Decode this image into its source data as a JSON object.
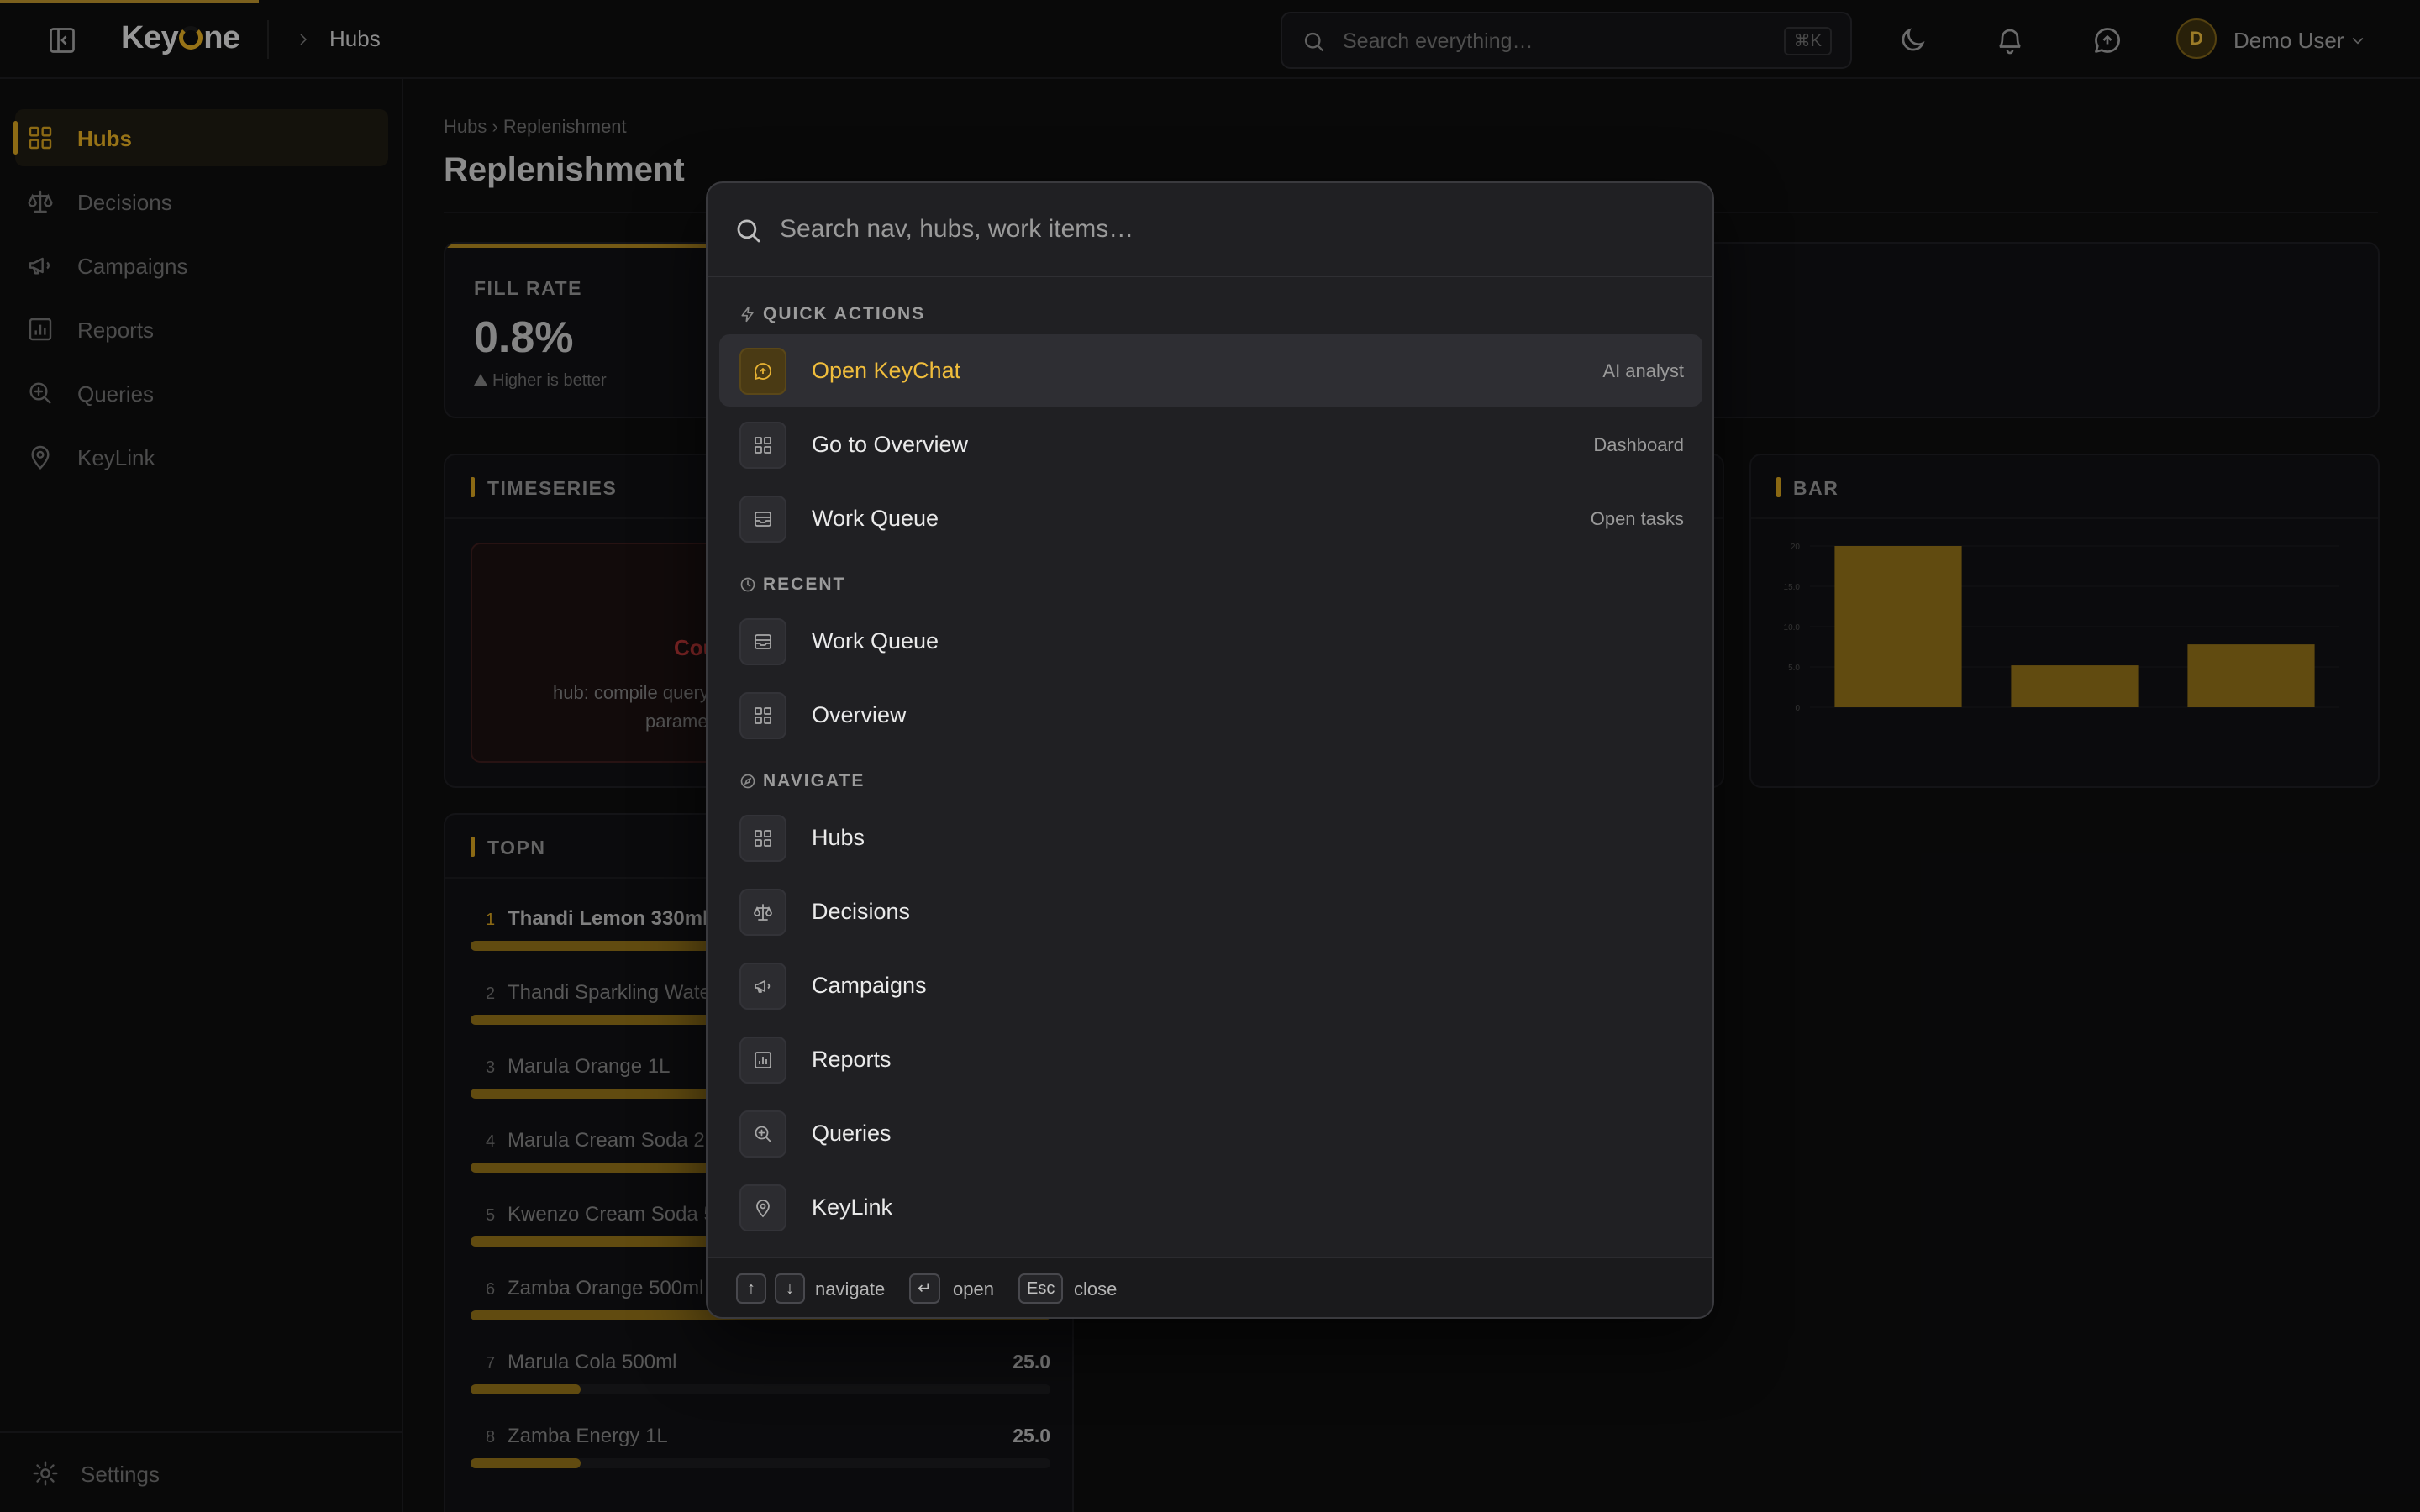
{
  "app": {
    "brand_prefix": "Key",
    "brand_suffix": "ne",
    "top_breadcrumb": "Hubs",
    "search_placeholder": "Search everything…",
    "search_shortcut": "⌘K",
    "user_initial": "D",
    "user_name": "Demo User"
  },
  "sidebar": {
    "items": [
      {
        "label": "Hubs",
        "icon": "grid-icon",
        "active": true
      },
      {
        "label": "Decisions",
        "icon": "scale-icon"
      },
      {
        "label": "Campaigns",
        "icon": "megaphone-icon"
      },
      {
        "label": "Reports",
        "icon": "bar-chart-icon"
      },
      {
        "label": "Queries",
        "icon": "search-zoom-icon"
      },
      {
        "label": "KeyLink",
        "icon": "map-pin-icon"
      }
    ],
    "settings_label": "Settings"
  },
  "main": {
    "breadcrumb": "Hubs › Replenishment",
    "title": "Replenishment",
    "kpi": {
      "label": "FILL RATE",
      "value": "0.8%",
      "hint": "Higher is better"
    },
    "timeseries": {
      "title": "TIMESERIES",
      "error_title": "Cou",
      "error_line1": "hub: compile query",
      "error_line2": "parame"
    },
    "bar_card": {
      "title": "BAR"
    },
    "topn": {
      "title": "TOPN",
      "rows": [
        {
          "rank": "1",
          "name": "Thandi Lemon 330ml",
          "value": "",
          "fill": 1.0
        },
        {
          "rank": "2",
          "name": "Thandi Sparkling Water",
          "value": "",
          "fill": 1.0
        },
        {
          "rank": "3",
          "name": "Marula Orange 1L",
          "value": "",
          "fill": 1.0
        },
        {
          "rank": "4",
          "name": "Marula Cream Soda 2L",
          "value": "",
          "fill": 1.0
        },
        {
          "rank": "5",
          "name": "Kwenzo Cream Soda 5",
          "value": "",
          "fill": 1.0
        },
        {
          "rank": "6",
          "name": "Zamba Orange 500ml",
          "value": "",
          "fill": 1.0
        },
        {
          "rank": "7",
          "name": "Marula Cola 500ml",
          "value": "25.0",
          "fill": 0.19
        },
        {
          "rank": "8",
          "name": "Zamba Energy 1L",
          "value": "25.0",
          "fill": 0.19
        }
      ]
    }
  },
  "chart_data": {
    "type": "bar",
    "title": "",
    "categories": [
      "",
      "",
      ""
    ],
    "values": [
      20.0,
      5.2,
      7.8
    ],
    "ylim": [
      0,
      20
    ],
    "yticks": [
      "0",
      "5.0",
      "10.0",
      "15.0",
      "20"
    ],
    "bar_color": "#8c6c18"
  },
  "palette": {
    "search_placeholder": "Search nav, hubs, work items…",
    "sections": {
      "quick_actions": "QUICK ACTIONS",
      "recent": "RECENT",
      "navigate": "NAVIGATE"
    },
    "quick_actions": [
      {
        "label": "Open KeyChat",
        "hint": "AI analyst",
        "icon": "chat-icon",
        "selected": true
      },
      {
        "label": "Go to Overview",
        "hint": "Dashboard",
        "icon": "grid-icon"
      },
      {
        "label": "Work Queue",
        "hint": "Open tasks",
        "icon": "inbox-icon"
      }
    ],
    "recent": [
      {
        "label": "Work Queue",
        "icon": "inbox-icon"
      },
      {
        "label": "Overview",
        "icon": "grid-icon"
      }
    ],
    "navigate": [
      {
        "label": "Hubs",
        "icon": "grid-icon"
      },
      {
        "label": "Decisions",
        "icon": "scale-icon"
      },
      {
        "label": "Campaigns",
        "icon": "megaphone-icon"
      },
      {
        "label": "Reports",
        "icon": "bar-chart-icon"
      },
      {
        "label": "Queries",
        "icon": "search-zoom-icon"
      },
      {
        "label": "KeyLink",
        "icon": "map-pin-icon"
      }
    ],
    "footer": {
      "up_key": "↑",
      "down_key": "↓",
      "navigate_label": "navigate",
      "enter_key": "↵",
      "open_label": "open",
      "esc_key": "Esc",
      "close_label": "close"
    }
  },
  "colors": {
    "accent": "#d9a521",
    "background": "#0d0d0e",
    "palette_bg": "#202023"
  }
}
